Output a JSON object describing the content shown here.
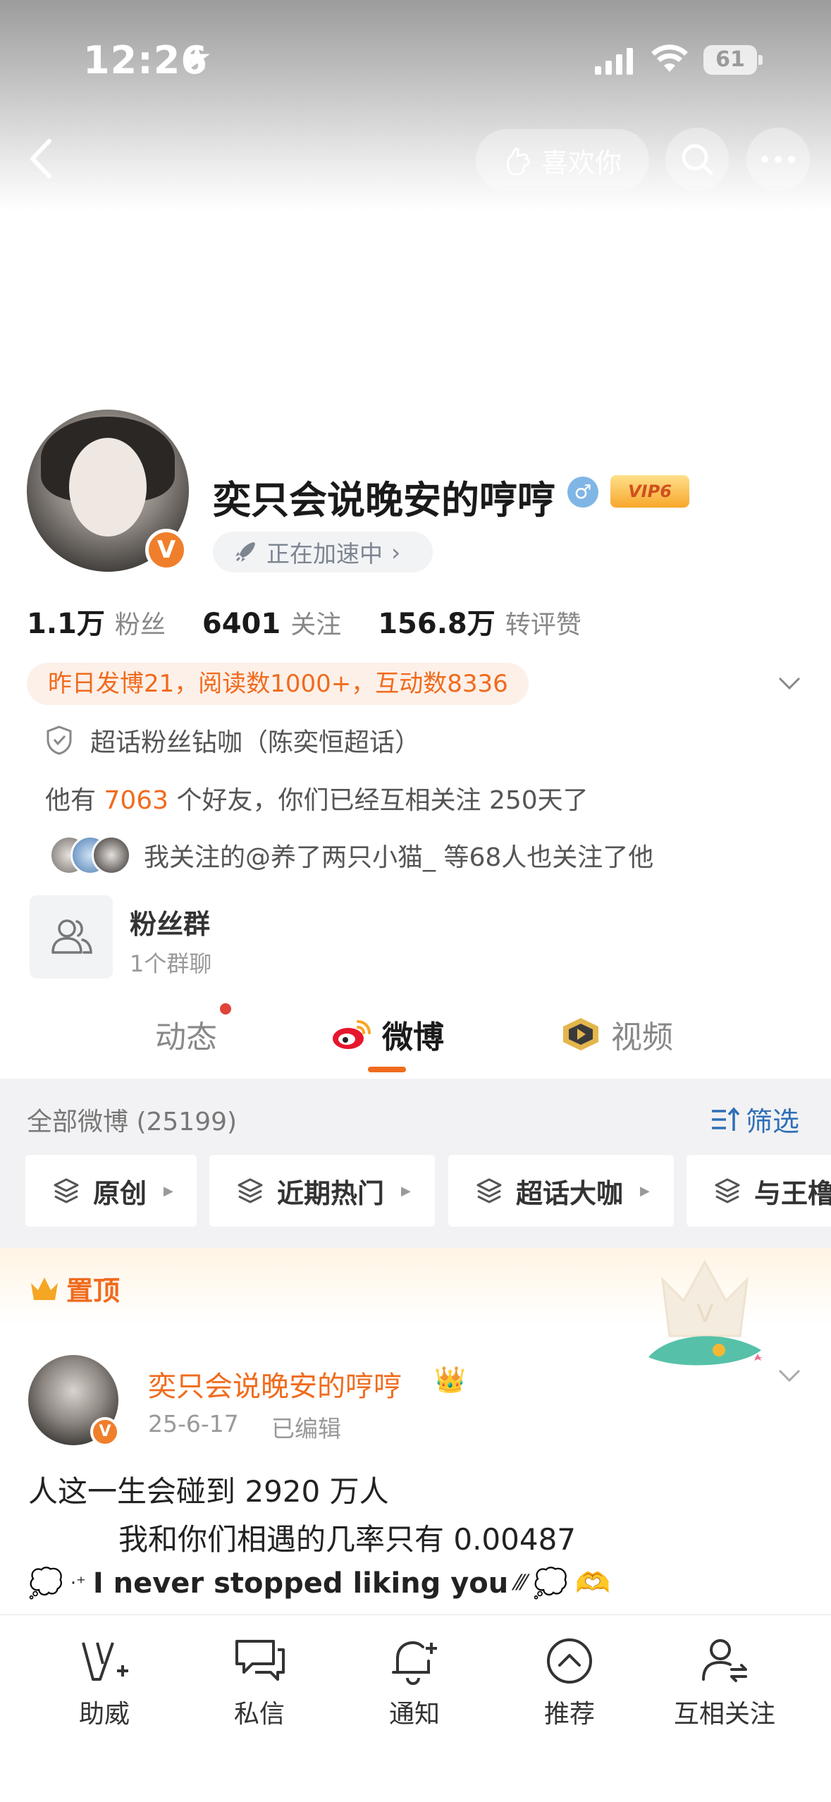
{
  "status_bar": {
    "time": "12:26",
    "battery": "61"
  },
  "nav": {
    "like_label": "喜欢你"
  },
  "profile": {
    "name": "奕只会说晚安的哼哼",
    "vip_label": "VIP6",
    "speed_label": "正在加速中",
    "stats": [
      {
        "num": "1.1万",
        "label": "粉丝"
      },
      {
        "num": "6401",
        "label": "关注"
      },
      {
        "num": "156.8万",
        "label": "转评赞"
      }
    ],
    "post_info": "昨日发博21，阅读数1000+，互动数8336",
    "supertopic": "超话粉丝钻咖（陈奕恒超话）",
    "friends_prefix": "他有 ",
    "friends_count": "7063",
    "friends_suffix": " 个好友，你们已经互相关注 250天了",
    "mutual_text": "我关注的@养了两只小猫_ 等68人也关注了他",
    "fan_group_title": "粉丝群",
    "fan_group_sub": "1个群聊"
  },
  "tabs": [
    {
      "label": "动态"
    },
    {
      "label": "微博"
    },
    {
      "label": "视频"
    }
  ],
  "feed": {
    "all_label": "全部微博 (25199)",
    "filter_label": "筛选",
    "chips": [
      "原创",
      "近期热门",
      "超话大咖",
      "与王橹"
    ]
  },
  "pinned": {
    "label": "置顶",
    "author": "奕只会说晚安的哼哼",
    "date": "25-6-17",
    "edited": "已编辑",
    "line1": "人这一生会碰到 2920 万人",
    "line2": "我和你们相遇的几率只有 0.00487",
    "line3": "I never stopped liking you"
  },
  "bottom_bar": [
    {
      "label": "助威",
      "icon": "cheer-icon"
    },
    {
      "label": "私信",
      "icon": "message-icon"
    },
    {
      "label": "通知",
      "icon": "bell-icon"
    },
    {
      "label": "推荐",
      "icon": "recommend-icon"
    },
    {
      "label": "互相关注",
      "icon": "mutual-follow-icon"
    }
  ],
  "colors": {
    "accent": "#f06b1d",
    "link": "#2f6fb6",
    "gray_bg": "#f2f2f4"
  }
}
